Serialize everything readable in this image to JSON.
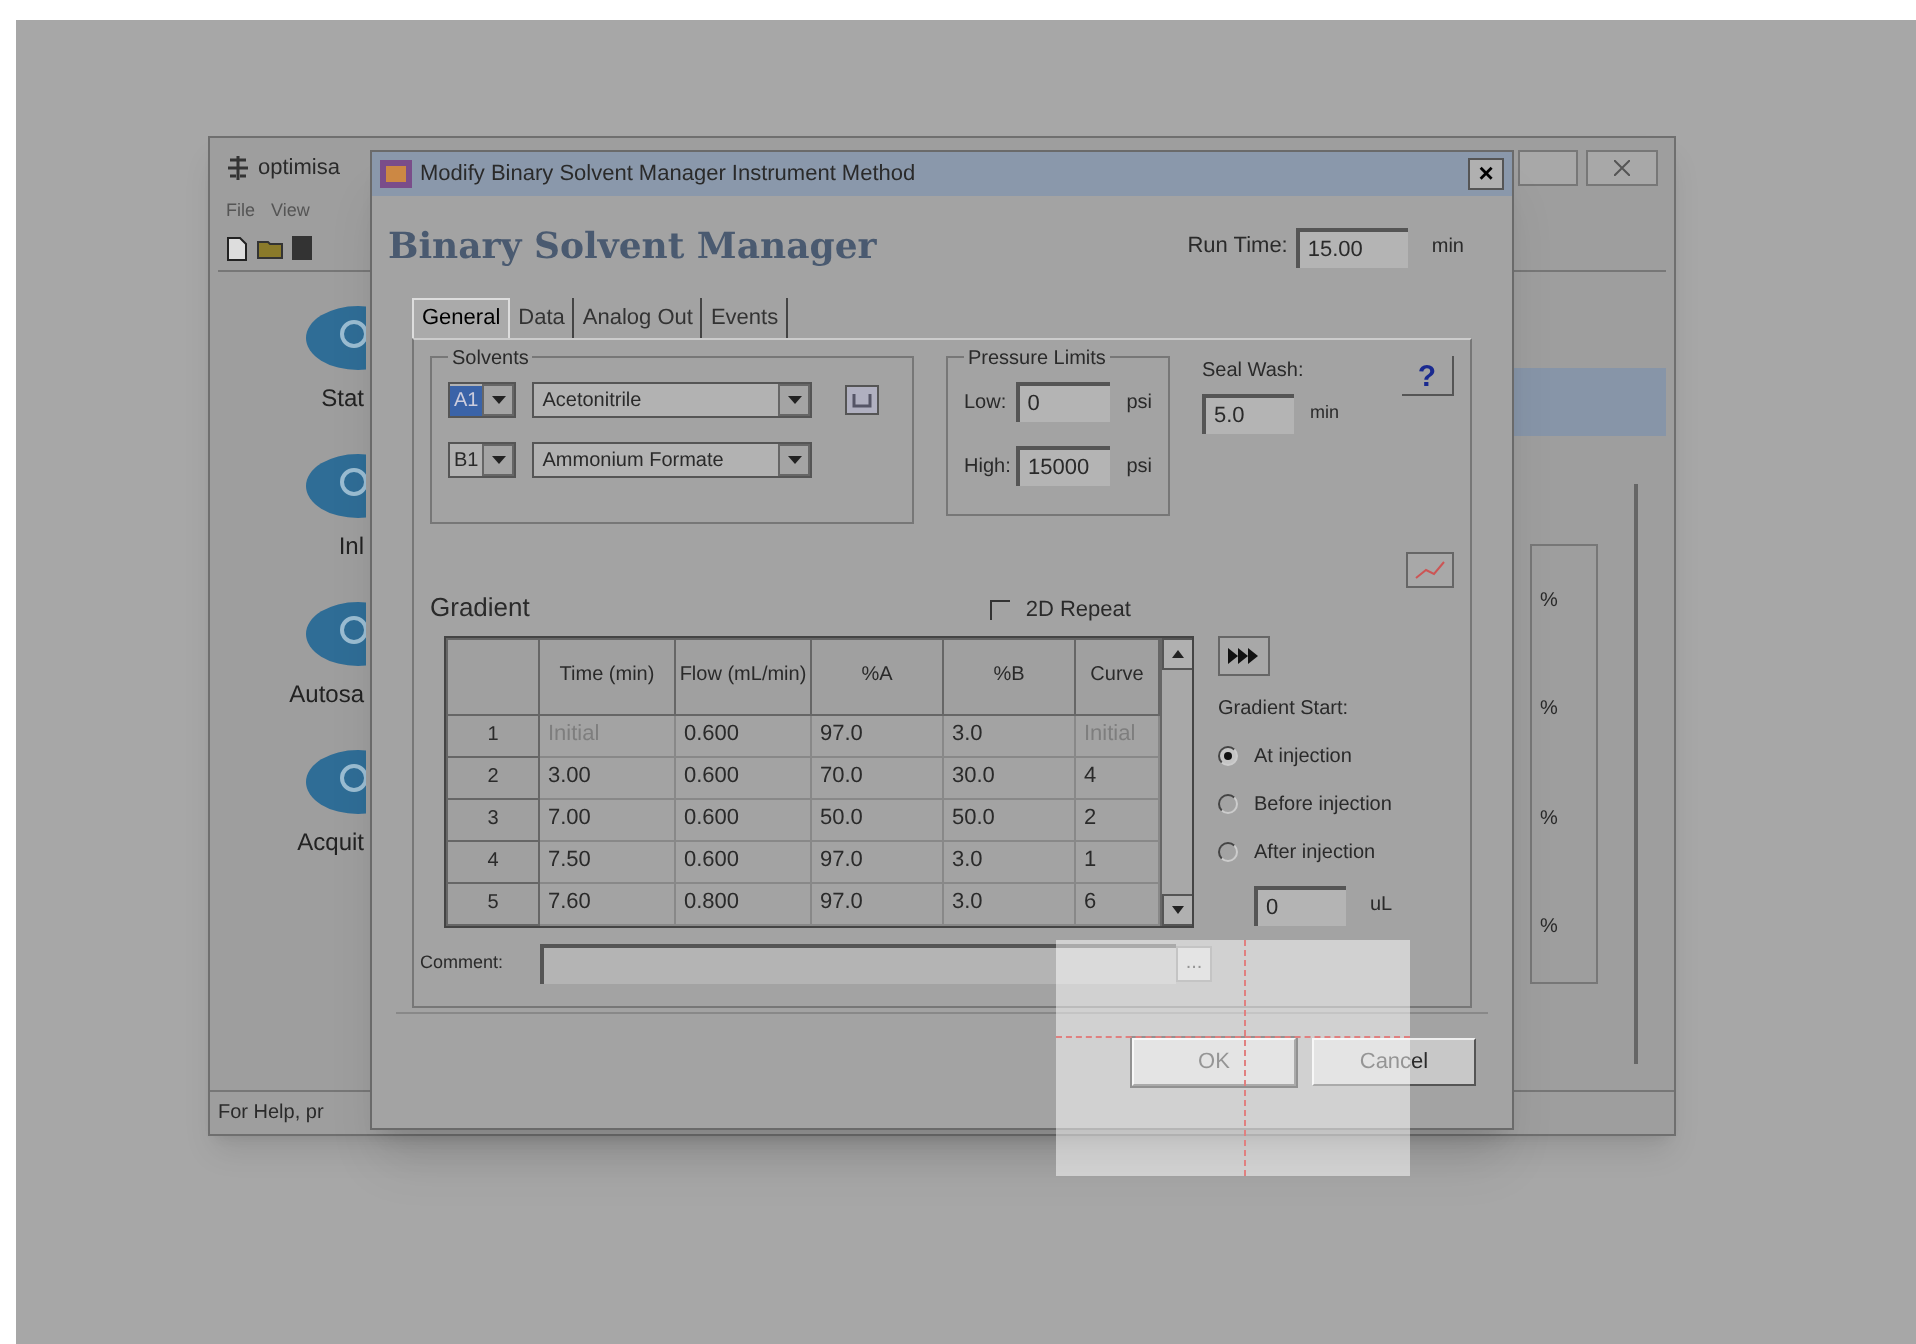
{
  "background_window": {
    "title": "optimisa",
    "menu": [
      "File",
      "View"
    ],
    "sidebar": [
      {
        "label": "Stat"
      },
      {
        "label": "Inl"
      },
      {
        "label": "Autosa"
      },
      {
        "label": "Acquit"
      }
    ],
    "side_labels": [
      "%",
      "%",
      "%",
      "%"
    ],
    "status_bar": "For Help, pr"
  },
  "dialog": {
    "title": "Modify Binary Solvent Manager Instrument Method",
    "close": "×",
    "heading": "Binary Solvent Manager",
    "run_time": {
      "label": "Run Time:",
      "value": "15.00",
      "unit": "min"
    },
    "tabs": [
      {
        "label": "General",
        "selected": true
      },
      {
        "label": "Data",
        "selected": false
      },
      {
        "label": "Analog Out",
        "selected": false
      },
      {
        "label": "Events",
        "selected": false
      }
    ],
    "solvents": {
      "title": "Solvents",
      "rows": [
        {
          "channel": "A1",
          "solvent": "Acetonitrile",
          "focused": true
        },
        {
          "channel": "B1",
          "solvent": "Ammonium Formate",
          "focused": false
        }
      ]
    },
    "pressure_limits": {
      "title": "Pressure Limits",
      "low": {
        "label": "Low:",
        "value": "0",
        "unit": "psi"
      },
      "high": {
        "label": "High:",
        "value": "15000",
        "unit": "psi"
      }
    },
    "seal_wash": {
      "label": "Seal Wash:",
      "value": "5.0",
      "unit": "min"
    },
    "help": "?",
    "gradient": {
      "title": "Gradient",
      "repeat": {
        "label": "2D Repeat",
        "checked": false
      },
      "columns": [
        "Time (min)",
        "Flow (mL/min)",
        "%A",
        "%B",
        "Curve"
      ],
      "rows": [
        {
          "index": "1",
          "time": "Initial",
          "flow": "0.600",
          "a": "97.0",
          "b": "3.0",
          "curve": "Initial",
          "initial": true
        },
        {
          "index": "2",
          "time": "3.00",
          "flow": "0.600",
          "a": "70.0",
          "b": "30.0",
          "curve": "4",
          "initial": false
        },
        {
          "index": "3",
          "time": "7.00",
          "flow": "0.600",
          "a": "50.0",
          "b": "50.0",
          "curve": "2",
          "initial": false
        },
        {
          "index": "4",
          "time": "7.50",
          "flow": "0.600",
          "a": "97.0",
          "b": "3.0",
          "curve": "1",
          "initial": false
        },
        {
          "index": "5",
          "time": "7.60",
          "flow": "0.800",
          "a": "97.0",
          "b": "3.0",
          "curve": "6",
          "initial": false
        }
      ]
    },
    "gradient_start": {
      "title": "Gradient Start:",
      "options": [
        {
          "label": "At injection",
          "selected": true
        },
        {
          "label": "Before injection",
          "selected": false
        },
        {
          "label": "After injection",
          "selected": false
        }
      ],
      "volume": {
        "value": "0",
        "unit": "uL"
      }
    },
    "comment": {
      "label": "Comment:",
      "browse": "..."
    },
    "buttons": [
      "OK",
      "Cancel"
    ]
  }
}
